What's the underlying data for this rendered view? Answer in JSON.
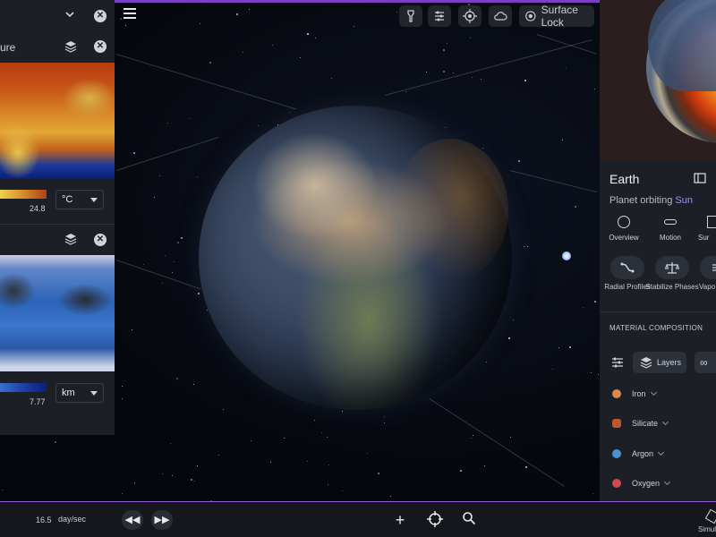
{
  "colors": {
    "accent": "#7a3fc2",
    "link": "#a98cf5",
    "panel": "#1c1f25"
  },
  "top_toolbar": {
    "surface_lock_label": "Surface Lock",
    "icons": [
      "flashlight-icon",
      "sliders-icon",
      "target-globe-icon",
      "cloud-icon",
      "surface-lock-icon"
    ]
  },
  "left_panel": {
    "temperature": {
      "title_fragment": "ure",
      "legend_max": "24.8",
      "unit": "°C"
    },
    "depth": {
      "legend_max": "7.77",
      "unit": "km"
    }
  },
  "right_panel": {
    "title": "Earth",
    "subtitle_prefix": "Planet orbiting ",
    "subtitle_link": "Sun",
    "tabs": [
      "Overview",
      "Motion",
      "Sur"
    ],
    "tools": [
      {
        "label": "Radial Profiles"
      },
      {
        "label": "Stabilize Phases"
      },
      {
        "label": "Vapo"
      }
    ],
    "section_title": "MATERIAL COMPOSITION",
    "layers_label": "Layers",
    "materials": [
      {
        "name": "Iron",
        "color": "#d98a4a"
      },
      {
        "name": "Silicate",
        "color": "#c0562a"
      },
      {
        "name": "Argon",
        "color": "#4a8fd0"
      },
      {
        "name": "Oxygen",
        "color": "#d04a4a"
      }
    ]
  },
  "bottom_bar": {
    "speed_value": "16.5",
    "speed_unit": "day/sec",
    "simulation_label": "Simul"
  }
}
